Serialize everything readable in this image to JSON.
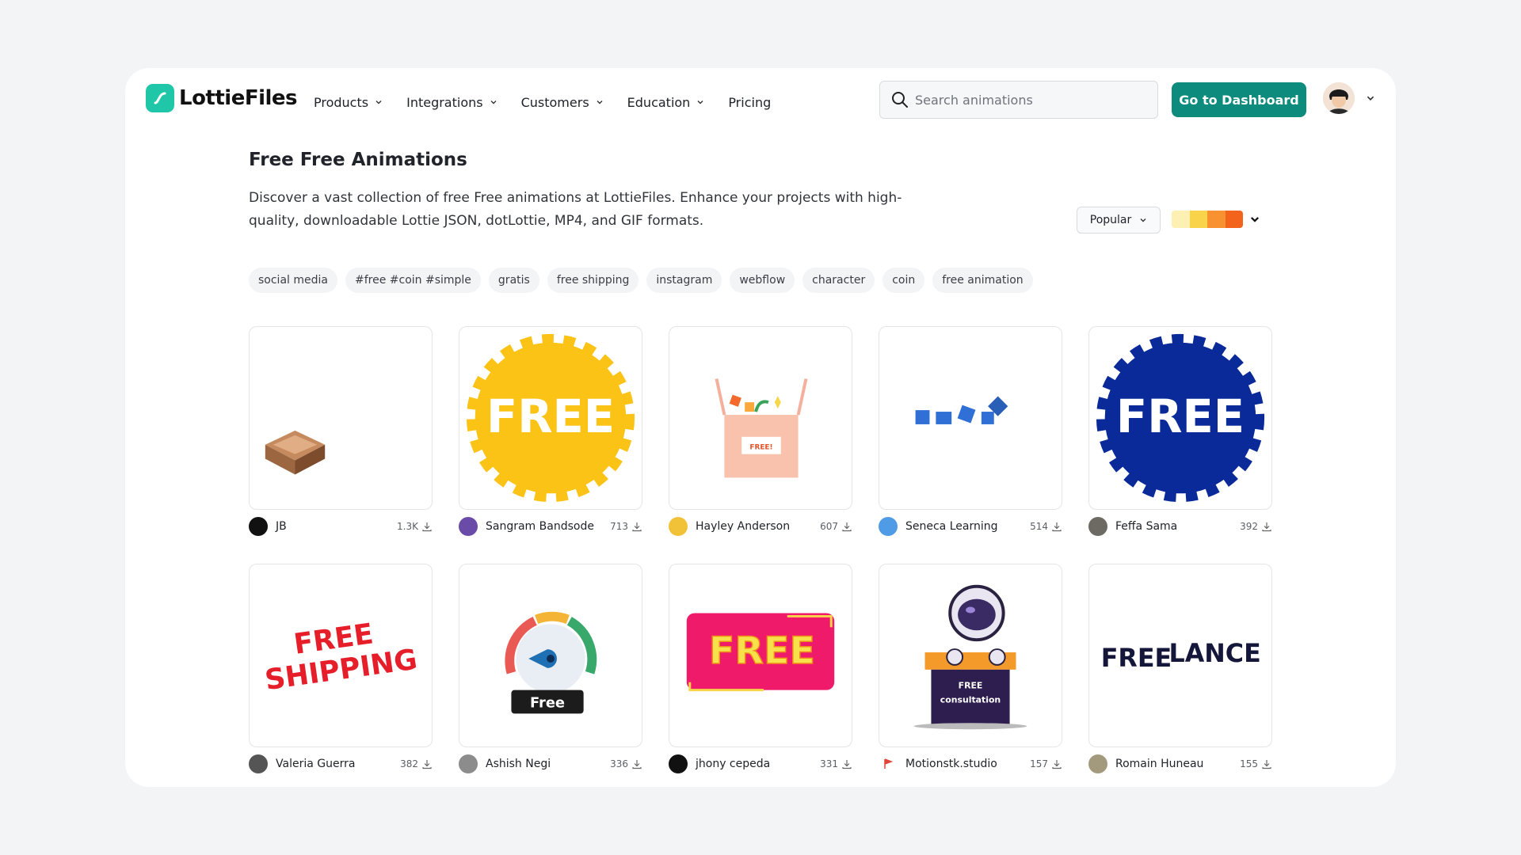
{
  "header": {
    "logo_text": "LottieFiles",
    "nav": [
      {
        "label": "Products",
        "has_menu": true
      },
      {
        "label": "Integrations",
        "has_menu": true
      },
      {
        "label": "Customers",
        "has_menu": true
      },
      {
        "label": "Education",
        "has_menu": true
      },
      {
        "label": "Pricing",
        "has_menu": false
      }
    ],
    "search_placeholder": "Search animations",
    "dashboard_label": "Go to Dashboard"
  },
  "main": {
    "title": "Free Free Animations",
    "description": "Discover a vast collection of free Free animations at LottieFiles. Enhance your projects with high-quality, downloadable Lottie JSON, dotLottie, MP4, and GIF formats.",
    "sort_label": "Popular",
    "palette_colors": [
      "#fdf0b3",
      "#f9d44a",
      "#f8912f",
      "#f4631b"
    ],
    "tags": [
      "social media",
      "#free #coin #simple",
      "gratis",
      "free shipping",
      "instagram",
      "webflow",
      "character",
      "coin",
      "free animation"
    ]
  },
  "cards": [
    {
      "author": "JB",
      "downloads": "1.3K",
      "thumb_icon": "box-icon"
    },
    {
      "author": "Sangram Bandsode",
      "downloads": "713",
      "thumb_icon": "free-yellow-badge",
      "thumb_text": "FREE"
    },
    {
      "author": "Hayley Anderson",
      "downloads": "607",
      "thumb_icon": "gift-box-icon",
      "thumb_text": "FREE!"
    },
    {
      "author": "Seneca Learning",
      "downloads": "514",
      "thumb_icon": "blue-squares-icon"
    },
    {
      "author": "Feffa Sama",
      "downloads": "392",
      "thumb_icon": "free-blue-badge",
      "thumb_text": "FREE"
    },
    {
      "author": "Valeria Guerra",
      "downloads": "382",
      "thumb_icon": "free-shipping-text",
      "thumb_text": "FREE",
      "thumb_text2": "SHIPPING"
    },
    {
      "author": "Ashish Negi",
      "downloads": "336",
      "thumb_icon": "gauge-icon",
      "thumb_text": "Free"
    },
    {
      "author": "jhony cepeda",
      "downloads": "331",
      "thumb_icon": "free-banner",
      "thumb_text": "FREE"
    },
    {
      "author": "Motionstk.studio",
      "downloads": "157",
      "thumb_icon": "astronaut-icon",
      "thumb_text": "FREE",
      "thumb_text2": "consultation"
    },
    {
      "author": "Romain Huneau",
      "downloads": "155",
      "thumb_icon": "freelance-text",
      "thumb_text": "FREE",
      "thumb_text2": "LANCE"
    }
  ]
}
